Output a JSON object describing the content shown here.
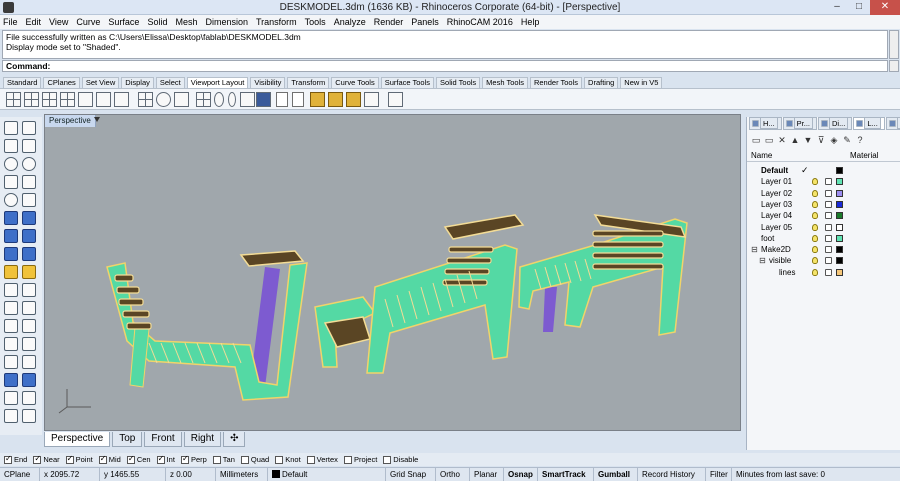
{
  "window": {
    "title": "DESKMODEL.3dm (1636 KB) - Rhinoceros Corporate (64-bit) - [Perspective]",
    "controls": [
      "–",
      "□",
      "✕"
    ]
  },
  "menu": [
    "File",
    "Edit",
    "View",
    "Curve",
    "Surface",
    "Solid",
    "Mesh",
    "Dimension",
    "Transform",
    "Tools",
    "Analyze",
    "Render",
    "Panels",
    "RhinoCAM 2016",
    "Help"
  ],
  "history": {
    "line1": "File successfully written as C:\\Users\\Elissa\\Desktop\\fablab\\DESKMODEL.3dm",
    "line2": "Display mode set to \"Shaded\"."
  },
  "command": {
    "label": "Command:",
    "value": ""
  },
  "toolbar_tabs": [
    "Standard",
    "CPlanes",
    "Set View",
    "Display",
    "Select",
    "Viewport Layout",
    "Visibility",
    "Transform",
    "Curve Tools",
    "Surface Tools",
    "Solid Tools",
    "Mesh Tools",
    "Render Tools",
    "Drafting",
    "New in V5"
  ],
  "active_toolbar_tab": "Viewport Layout",
  "viewport": {
    "title": "Perspective",
    "display_mode": "Shaded",
    "colors": {
      "background": "#a0a7ac",
      "body": "#54d9a4",
      "body_edge": "#f0d46a",
      "slat_top": "#5a4524",
      "slat_edge": "#f3dc96",
      "shadow": "#7d5bd0"
    }
  },
  "viewport_tabs": [
    "Perspective",
    "Top",
    "Front",
    "Right",
    "✣"
  ],
  "active_viewport_tab": "Perspective",
  "osnap": [
    {
      "label": "End",
      "checked": true
    },
    {
      "label": "Near",
      "checked": true
    },
    {
      "label": "Point",
      "checked": true
    },
    {
      "label": "Mid",
      "checked": true
    },
    {
      "label": "Cen",
      "checked": true
    },
    {
      "label": "Int",
      "checked": true
    },
    {
      "label": "Perp",
      "checked": true
    },
    {
      "label": "Tan",
      "checked": false
    },
    {
      "label": "Quad",
      "checked": false
    },
    {
      "label": "Knot",
      "checked": false
    },
    {
      "label": "Vertex",
      "checked": false
    },
    {
      "label": "Project",
      "checked": false
    },
    {
      "label": "Disable",
      "checked": false
    }
  ],
  "status": {
    "cplane": "CPlane",
    "x": "x 2095.72",
    "y": "y 1465.55",
    "z": "z 0.00",
    "units": "Millimeters",
    "layer": "Default",
    "grid_snap": "Grid Snap",
    "ortho": "Ortho",
    "planar": "Planar",
    "osnap": "Osnap",
    "smarttrack": "SmartTrack",
    "gumball": "Gumball",
    "record_history": "Record History",
    "filter": "Filter",
    "autosave": "Minutes from last save: 0"
  },
  "panel": {
    "tabs": [
      "H...",
      "Pr...",
      "Di...",
      "L...",
      "B..."
    ],
    "active_tab": "L...",
    "tools": [
      "▭",
      "▭",
      "✕",
      "▲",
      "▼",
      "⊽",
      "◈",
      "✎",
      "?"
    ],
    "columns": {
      "name": "Name",
      "material": "Material"
    },
    "layers": [
      {
        "name": "Default",
        "bold": true,
        "current": true,
        "color": "#000000",
        "indent": 0,
        "tree": ""
      },
      {
        "name": "Layer 01",
        "bold": false,
        "current": false,
        "color": "#5fe3b3",
        "indent": 0,
        "tree": ""
      },
      {
        "name": "Layer 02",
        "bold": false,
        "current": false,
        "color": "#9b8cf0",
        "indent": 0,
        "tree": ""
      },
      {
        "name": "Layer 03",
        "bold": false,
        "current": false,
        "color": "#1a2ad8",
        "indent": 0,
        "tree": ""
      },
      {
        "name": "Layer 04",
        "bold": false,
        "current": false,
        "color": "#1a7a2a",
        "indent": 0,
        "tree": ""
      },
      {
        "name": "Layer 05",
        "bold": false,
        "current": false,
        "color": "#ffffff",
        "indent": 0,
        "tree": ""
      },
      {
        "name": "foot",
        "bold": false,
        "current": false,
        "color": "#5fe3b3",
        "indent": 0,
        "tree": ""
      },
      {
        "name": "Make2D",
        "bold": false,
        "current": false,
        "color": "#000000",
        "indent": 0,
        "tree": "⊟"
      },
      {
        "name": "visible",
        "bold": false,
        "current": false,
        "color": "#000000",
        "indent": 1,
        "tree": "⊟"
      },
      {
        "name": "lines",
        "bold": false,
        "current": false,
        "color": "#f5c77a",
        "indent": 2,
        "tree": ""
      }
    ]
  }
}
